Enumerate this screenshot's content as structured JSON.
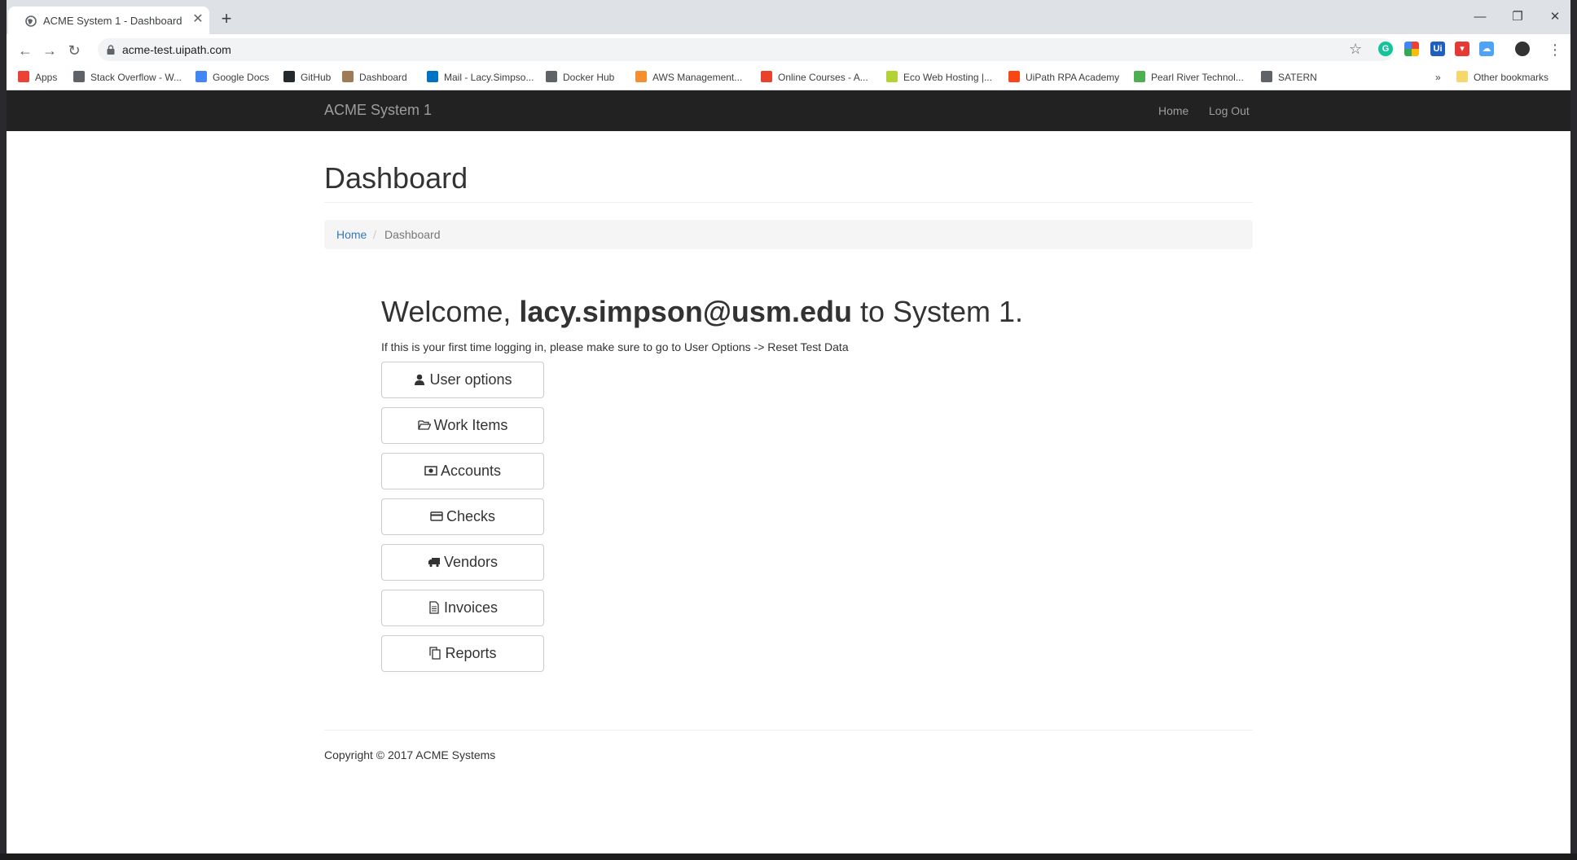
{
  "browser": {
    "tab": {
      "title": "ACME System 1 - Dashboard",
      "close": "✕",
      "favicon": "globe-icon"
    },
    "new_tab": "+",
    "window_controls": [
      "—",
      "❐",
      "✕"
    ],
    "url": "acme-test.uipath.com",
    "bookmarks": [
      {
        "label": "Apps",
        "icon": "apps-grid-icon",
        "color": "#ea4335"
      },
      {
        "label": "Stack Overflow - W...",
        "icon": "globe-icon",
        "color": "#5f6368"
      },
      {
        "label": "Google Docs",
        "icon": "docs-icon",
        "color": "#4285f4"
      },
      {
        "label": "GitHub",
        "icon": "github-icon",
        "color": "#24292e"
      },
      {
        "label": "Dashboard",
        "icon": "dashboard-icon",
        "color": "#9e7b54"
      },
      {
        "label": "Mail - Lacy.Simpso...",
        "icon": "outlook-icon",
        "color": "#0072c6"
      },
      {
        "label": "Docker Hub",
        "icon": "globe-icon",
        "color": "#5f6368"
      },
      {
        "label": "AWS Management...",
        "icon": "aws-icon",
        "color": "#f68d2e"
      },
      {
        "label": "Online Courses - A...",
        "icon": "udemy-icon",
        "color": "#e8412c"
      },
      {
        "label": "Eco Web Hosting |...",
        "icon": "leaf-icon",
        "color": "#b3d334"
      },
      {
        "label": "UiPath RPA Academy",
        "icon": "uipath-icon",
        "color": "#fa4616"
      },
      {
        "label": "Pearl River Technol...",
        "icon": "prcc-icon",
        "color": "#4caf50"
      },
      {
        "label": "SATERN",
        "icon": "globe-icon",
        "color": "#5f6368"
      }
    ],
    "overflow": "»",
    "other_bookmarks": "Other bookmarks"
  },
  "site": {
    "brand": "ACME System 1",
    "nav": {
      "home": "Home",
      "logout": "Log Out"
    },
    "page_title": "Dashboard",
    "breadcrumb": {
      "home": "Home",
      "sep": "/",
      "current": "Dashboard"
    },
    "welcome": {
      "prefix": "Welcome, ",
      "user": "lacy.simpson@usm.edu",
      "suffix": " to System 1."
    },
    "hint": "If this is your first time logging in, please make sure to go to User Options -> Reset Test Data",
    "buttons": [
      {
        "label": "User options",
        "icon": "user-icon"
      },
      {
        "label": "Work Items",
        "icon": "folder-open-icon"
      },
      {
        "label": "Accounts",
        "icon": "money-icon"
      },
      {
        "label": "Checks",
        "icon": "credit-card-icon"
      },
      {
        "label": "Vendors",
        "icon": "truck-icon"
      },
      {
        "label": "Invoices",
        "icon": "document-icon"
      },
      {
        "label": "Reports",
        "icon": "copy-icon"
      }
    ],
    "copyright": "Copyright © 2017 ACME Systems"
  }
}
